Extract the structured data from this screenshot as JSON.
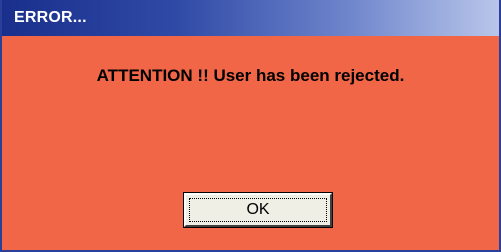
{
  "window": {
    "title": "ERROR...",
    "background_color": "#f06646",
    "titlebar_color": "#1a2f8c"
  },
  "dialog": {
    "message": "ATTENTION !! User has been rejected.",
    "ok_label": "OK"
  }
}
